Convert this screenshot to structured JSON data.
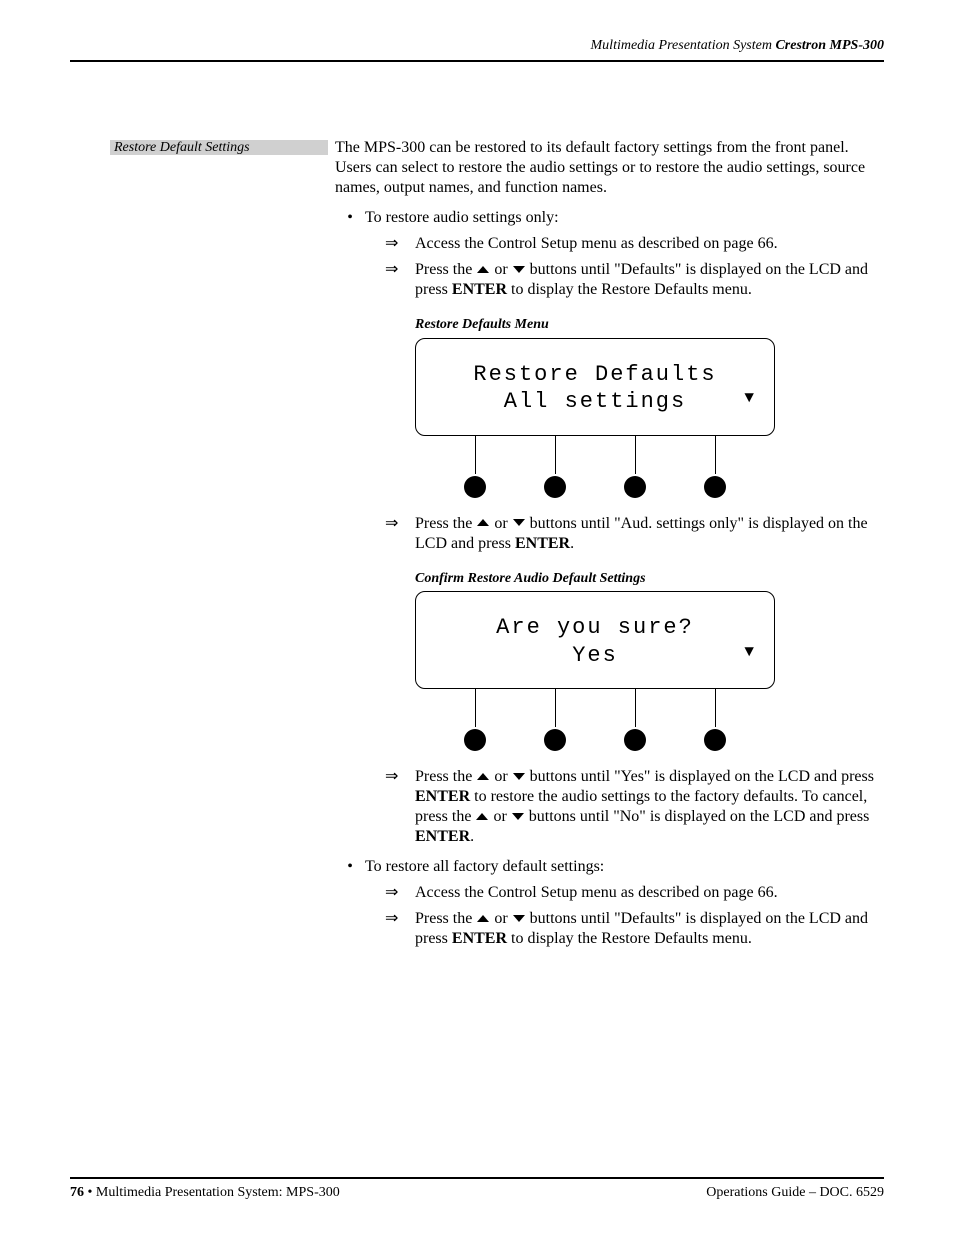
{
  "header": {
    "right": "Multimedia Presentation System",
    "right_em": "Crestron MPS-300"
  },
  "sidebar": "Restore Default Settings",
  "intro": "The MPS-300 can be restored to its default factory settings from the front panel. Users can select to restore the audio settings or to restore the audio settings, source names, output names, and function names.",
  "bullets": {
    "b1": "To restore audio settings only:",
    "b2": "To restore all factory default settings:"
  },
  "steps": {
    "s_access": "Access the Control Setup menu as described on page 66.",
    "s_defaults_a": "Press the ",
    "s_or": " or ",
    "s_defaults_b": " buttons until \"Defaults\" is displayed on the LCD and press ",
    "s_defaults_c": " to display the Restore Defaults menu.",
    "s_aud_a": "Press the ",
    "s_aud_b": " buttons until \"Aud. settings only\" is displayed on the LCD and press ",
    "s_aud_c": ".",
    "s_yes_a": "Press the ",
    "s_yes_b": " buttons until \"Yes\" is displayed on the LCD and press ",
    "s_yes_c": " to restore the audio settings to the factory defaults. To cancel, press the ",
    "s_yes_d": " buttons until \"No\" is displayed on the LCD and press ",
    "s_yes_e": "."
  },
  "enter": "ENTER",
  "captions": {
    "fig1": "Restore Defaults Menu",
    "fig2": "Confirm Restore Audio Default Settings"
  },
  "lcd": {
    "fig1_line1": "Restore Defaults",
    "fig1_line2": "All settings",
    "fig2_line1": "Are you sure?",
    "fig2_line2": "Yes",
    "down_arrow": "▼"
  },
  "footer": {
    "left_page": "76",
    "left_bullet": " • ",
    "left_text": "Multimedia Presentation System: MPS-300",
    "right_text": "Operations Guide – DOC. 6529"
  }
}
